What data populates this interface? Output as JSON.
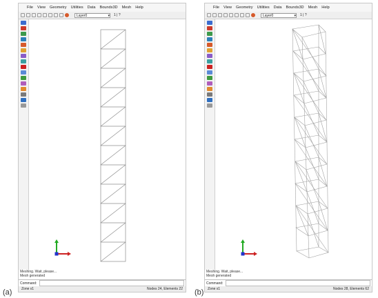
{
  "menu": [
    "File",
    "View",
    "Geometry",
    "Utilities",
    "Data",
    "Bounds3D",
    "Mesh",
    "Help"
  ],
  "layer": "Layer0",
  "toolbar_extra": "1 | ?",
  "panels": [
    {
      "tag": "(a)",
      "message_line1": "Meshing. Wait, please...",
      "message_line2": "Mesh generated",
      "command_label": "Command:",
      "zone": "Zone  x1",
      "counts": "Nodes 24, Elements 22"
    },
    {
      "tag": "(b)",
      "message_line1": "Meshing. Wait, please...",
      "message_line2": "Mesh generated",
      "command_label": "Command:",
      "zone": "Zone  x1",
      "counts": "Nodes 28, Elements 62"
    }
  ],
  "colors": {
    "axis_x": "#cc2222",
    "axis_y": "#22aa22",
    "axis_z": "#2233cc",
    "mesh": "#8c8c8c"
  }
}
